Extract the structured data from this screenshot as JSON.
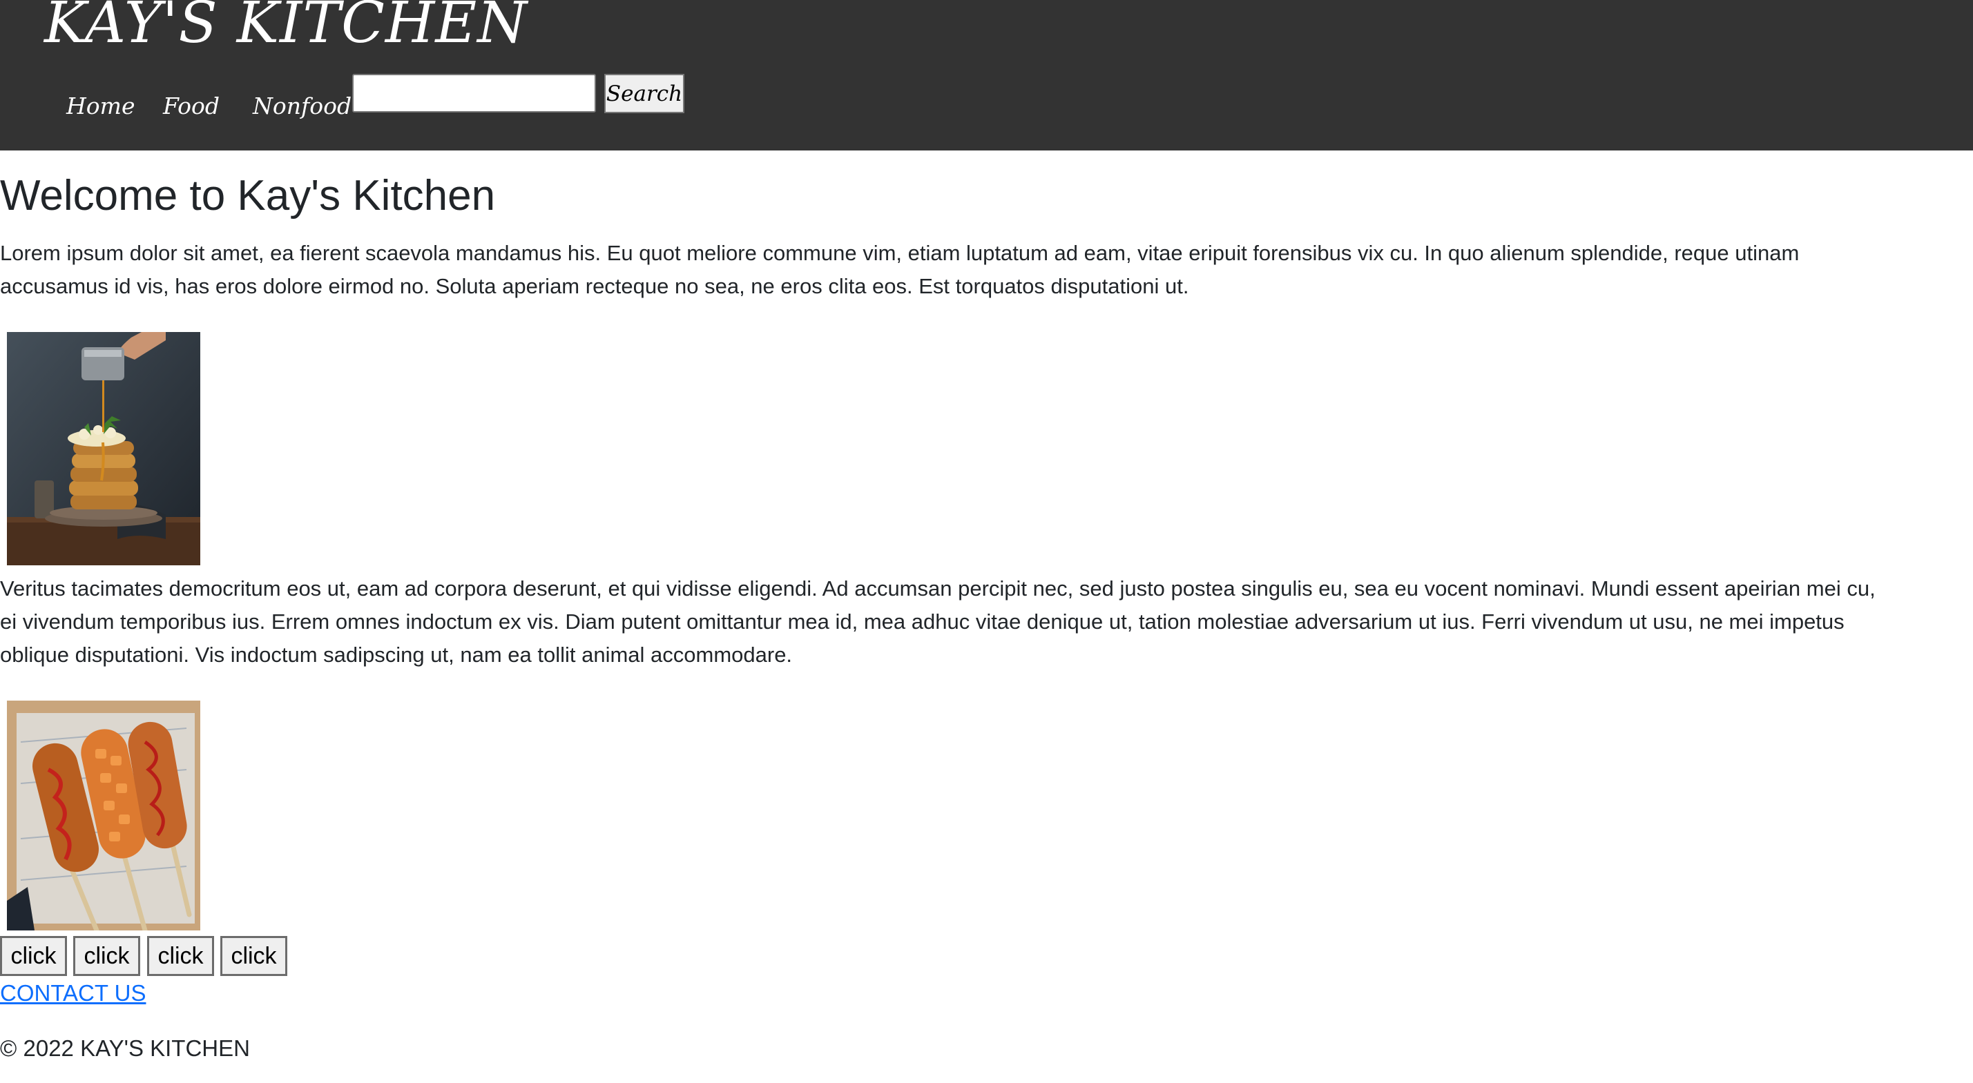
{
  "header": {
    "site_title": "KAY'S KITCHEN",
    "nav": [
      "Home",
      "Food",
      "Nonfood"
    ],
    "search": {
      "value": "",
      "placeholder": "",
      "button_label": "Search"
    }
  },
  "main": {
    "heading": "Welcome to Kay's Kitchen",
    "paragraph_1_lines": [
      "Lorem ipsum dolor sit amet, ea fierent scaevola mandamus his. Eu quot meliore commune vim, etiam luptatum ad eam, vitae eripuit forensibus vix cu. In quo alienum splendide, reque utinam",
      "accusamus id vis, has eros dolore eirmod no. Soluta aperiam recteque no sea, ne eros clita eos. Est torquatos disputationi ut."
    ],
    "images": [
      "pancake-stack-photo",
      "corn-dogs-photo"
    ],
    "paragraph_2_lines": [
      "Veritus tacimates democritum eos ut, eam ad corpora deserunt, et qui vidisse eligendi. Ad accumsan percipit nec, sed justo postea singulis eu, sea eu vocent nominavi. Mundi essent apeirian mei cu,",
      "ei vivendum temporibus ius. Errem omnes indoctum ex vis. Diam putent omittantur mea id, mea adhuc vitae denique ut, tation molestiae adversarium ut ius. Ferri vivendum ut usu, ne mei impetus",
      "oblique disputationi. Vis indoctum sadipscing ut, nam ea tollit animal accommodare."
    ],
    "buttons": [
      "click",
      "click",
      "click",
      "click"
    ],
    "contact_link": "CONTACT US"
  },
  "footer": {
    "copyright": "© 2022 KAY'S KITCHEN"
  },
  "colors": {
    "header_bg": "#333333",
    "header_text": "#ffffff",
    "link": "#0d6efd",
    "body_text": "#212529"
  }
}
